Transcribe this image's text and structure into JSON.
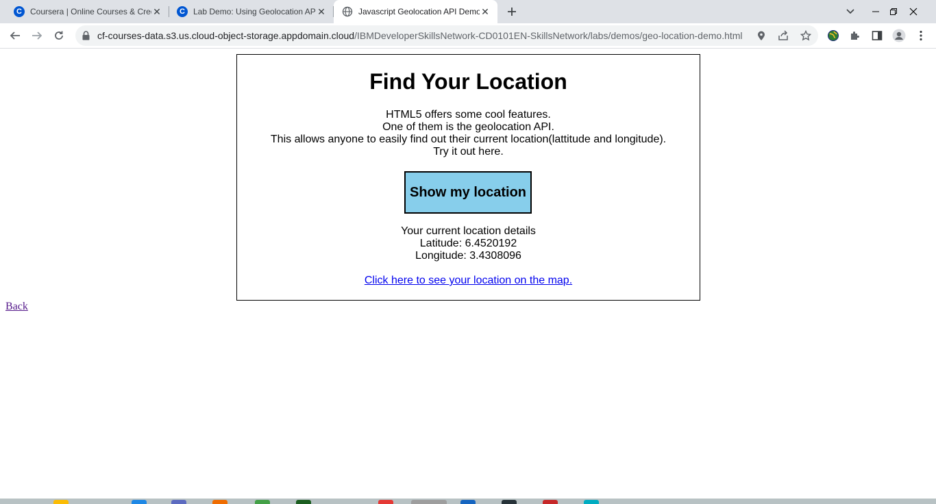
{
  "browser": {
    "tabs": [
      {
        "title": "Coursera | Online Courses & Credentials",
        "favicon": "coursera-icon",
        "active": false
      },
      {
        "title": "Lab Demo: Using Geolocation API",
        "favicon": "coursera-icon",
        "active": false
      },
      {
        "title": "Javascript Geolocation API Demo",
        "favicon": "globe-icon",
        "active": true
      }
    ],
    "url_host": "cf-courses-data.s3.us.cloud-object-storage.appdomain.cloud",
    "url_path": "/IBMDeveloperSkillsNetwork-CD0101EN-SkillsNetwork/labs/demos/geo-location-demo.html"
  },
  "page": {
    "heading": "Find Your Location",
    "intro": [
      "HTML5 offers some cool features.",
      "One of them is the geolocation API.",
      "This allows anyone to easily find out their current location(lattitude and longitude).",
      "Try it out here."
    ],
    "button_label": "Show my location",
    "details_title": "Your current location details",
    "latitude": "Latitude: 6.4520192",
    "longitude": "Longitude: 3.4308096",
    "map_link": "Click here to see your location on the map.",
    "back_link": "Back"
  },
  "colors": {
    "button_bg": "#87ceeb",
    "link": "#0000ee",
    "visited_link": "#551a8b",
    "tabstrip_bg": "#dee1e6"
  }
}
